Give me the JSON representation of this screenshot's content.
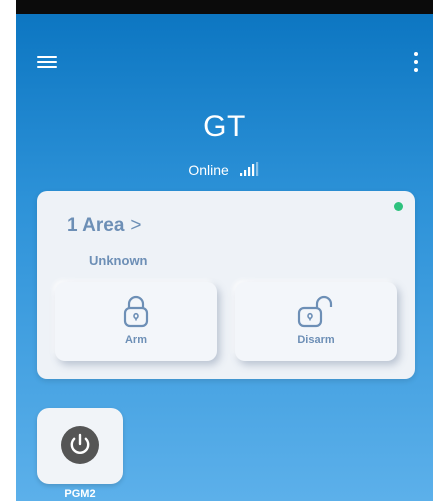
{
  "header": {
    "device_name": "GT",
    "connection_status": "Online"
  },
  "area_card": {
    "title": "1 Area",
    "chevron": ">",
    "state": "Unknown",
    "arm_label": "Arm",
    "disarm_label": "Disarm"
  },
  "pgm": {
    "label": "PGM2"
  },
  "icons": {
    "menu": "hamburger-menu-icon",
    "more": "more-vertical-icon",
    "signal": "signal-strength-icon",
    "arm": "padlock-closed-icon",
    "disarm": "padlock-open-icon",
    "pgm": "power-icon"
  },
  "colors": {
    "background_top": "#0a74c0",
    "background_bottom": "#5cb0ea",
    "card": "#eef2f7",
    "accent_text": "#6d8fb6",
    "online_dot": "#2ec27e",
    "power_icon": "#555555"
  }
}
